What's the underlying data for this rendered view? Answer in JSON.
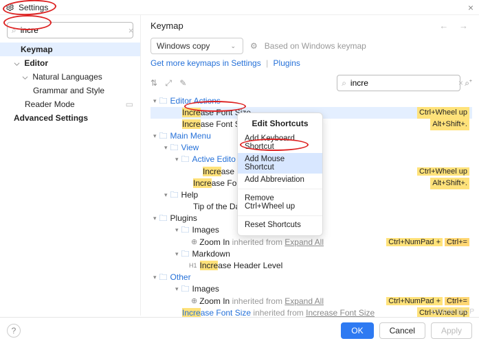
{
  "window": {
    "title": "Settings"
  },
  "sidebar": {
    "search_value": "incre",
    "items": {
      "keymap": "Keymap",
      "editor": "Editor",
      "natlang": "Natural Languages",
      "grammar": "Grammar and Style",
      "reader": "Reader Mode",
      "advanced": "Advanced Settings"
    }
  },
  "main": {
    "title": "Keymap",
    "scheme": "Windows copy",
    "basedon": "Based on Windows keymap",
    "getmore": "Get more keymaps in Settings",
    "plugins_link": "Plugins",
    "find_value": "incre"
  },
  "tree": {
    "editor_actions": "Editor Actions",
    "incfs": "Increase Font Size",
    "incfs_pre": "Incre",
    "incfs_post": "ase Font Size",
    "incfs2_pre": "Incre",
    "incfs2_post": "ase Font Si",
    "sc_wheel": "Ctrl+Wheel up",
    "sc_alt": "Alt+Shift+.",
    "mainmenu": "Main Menu",
    "view": "View",
    "active_editor": "Active Edito",
    "incf_short": "Increase F",
    "incf_pre": "Incre",
    "incf_post": "ase F",
    "incfont_pre": "Incre",
    "incfont_post": "ase Font",
    "help": "Help",
    "tip": "Tip of the Day",
    "plugins": "Plugins",
    "images": "Images",
    "zoomin": "Zoom In",
    "inherited": "inherited from",
    "expandall": "Expand All",
    "sc_numpad": "Ctrl+NumPad +",
    "sc_ctrleq": "Ctrl+=",
    "markdown": "Markdown",
    "h1": "H1",
    "inchdr_pre": "Incre",
    "inchdr_post": "ase Header Level",
    "other": "Other",
    "incfs_link_pre": "Incre",
    "incfs_link_post": "ase Font Size"
  },
  "menu": {
    "title": "Edit Shortcuts",
    "addkb": "Add Keyboard Shortcut",
    "addmouse": "Add Mouse Shortcut",
    "addabbr": "Add Abbreviation",
    "remove": "Remove Ctrl+Wheel up",
    "reset": "Reset Shortcuts"
  },
  "footer": {
    "ok": "OK",
    "cancel": "Cancel",
    "apply": "Apply"
  },
  "watermark": "CSDN @CP"
}
